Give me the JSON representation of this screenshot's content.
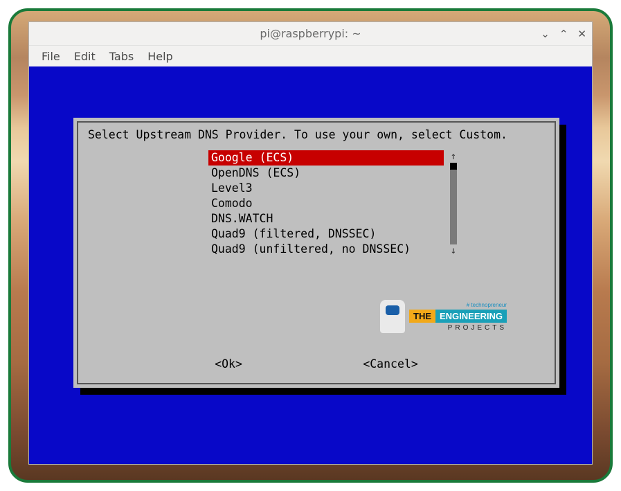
{
  "window": {
    "title": "pi@raspberrypi: ~",
    "controls": {
      "minimize": "⌄",
      "maximize": "⌃",
      "close": "✕"
    }
  },
  "menubar": {
    "items": [
      {
        "label": "File"
      },
      {
        "label": "Edit"
      },
      {
        "label": "Tabs"
      },
      {
        "label": "Help"
      }
    ]
  },
  "dialog": {
    "prompt": "Select Upstream DNS Provider. To use your own, select Custom.",
    "options": [
      {
        "label": "Google (ECS)",
        "selected": true
      },
      {
        "label": "OpenDNS (ECS)",
        "selected": false
      },
      {
        "label": "Level3",
        "selected": false
      },
      {
        "label": "Comodo",
        "selected": false
      },
      {
        "label": "DNS.WATCH",
        "selected": false
      },
      {
        "label": "Quad9 (filtered, DNSSEC)",
        "selected": false
      },
      {
        "label": "Quad9 (unfiltered, no DNSSEC)",
        "selected": false
      }
    ],
    "scroll": {
      "up": "↑",
      "down": "↓"
    },
    "buttons": {
      "ok": "<Ok>",
      "cancel": "<Cancel>"
    }
  },
  "watermark": {
    "tagline": "# technopreneur",
    "the": "THE",
    "engineering": "ENGINEERING",
    "projects": "PROJECTS"
  }
}
